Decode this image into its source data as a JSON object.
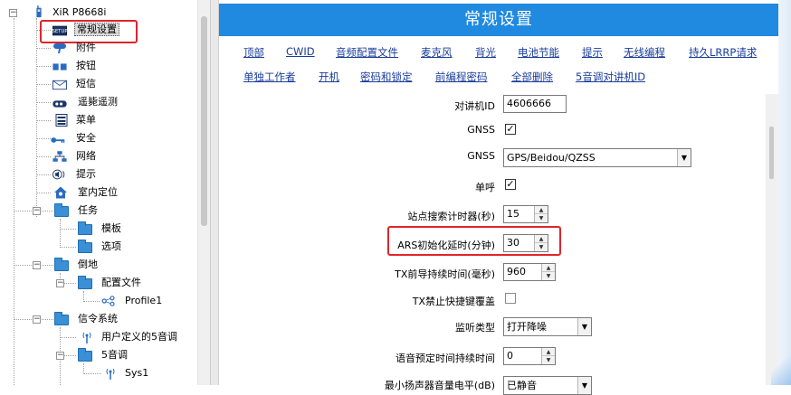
{
  "tree": {
    "root": "XiR P8668i",
    "items": [
      {
        "label": "常规设置",
        "icon": "setting-badge-icon"
      },
      {
        "label": "附件",
        "icon": "accessory-icon"
      },
      {
        "label": "按钮",
        "icon": "button-icon"
      },
      {
        "label": "短信",
        "icon": "envelope-icon"
      },
      {
        "label": "遥毙遥测",
        "icon": "remote-icon"
      },
      {
        "label": "菜单",
        "icon": "menu-icon"
      },
      {
        "label": "安全",
        "icon": "key-icon"
      },
      {
        "label": "网络",
        "icon": "network-icon"
      },
      {
        "label": "提示",
        "icon": "speaker-icon"
      },
      {
        "label": "室内定位",
        "icon": "home-location-icon"
      },
      {
        "label": "任务",
        "icon": "folder-icon"
      },
      {
        "label": "模板",
        "icon": "folder-icon"
      },
      {
        "label": "选项",
        "icon": "folder-icon"
      },
      {
        "label": "倒地",
        "icon": "folder-icon"
      },
      {
        "label": "配置文件",
        "icon": "folder-icon"
      },
      {
        "label": "Profile1",
        "icon": "profile-icon"
      },
      {
        "label": "信令系统",
        "icon": "folder-icon"
      },
      {
        "label": "用户定义的5音调",
        "icon": "antenna-icon"
      },
      {
        "label": "5音调",
        "icon": "folder-icon"
      },
      {
        "label": "Sys1",
        "icon": "antenna-icon"
      }
    ]
  },
  "panel": {
    "title": "常规设置",
    "links_row1": [
      "顶部",
      "CWID",
      "音频配置文件",
      "麦克风",
      "背光",
      "电池节能",
      "提示",
      "无线编程",
      "持久LRRP请求"
    ],
    "links_row2": [
      "单独工作者",
      "开机",
      "密码和锁定",
      "前编程密码",
      "全部删除",
      "5音调对讲机ID"
    ]
  },
  "fields": {
    "radio_id": {
      "label": "对讲机ID",
      "value": "4606666"
    },
    "gnss": {
      "label": "GNSS",
      "checked": true,
      "mark": "✓"
    },
    "gnss_mode": {
      "label": "GNSS",
      "value": "GPS/Beidou/QZSS"
    },
    "single_call": {
      "label": "单呼",
      "checked": true,
      "mark": "✓"
    },
    "site_search_timer": {
      "label": "站点搜索计时器(秒)",
      "value": "15"
    },
    "ars_init_delay": {
      "label": "ARS初始化延时(分钟)",
      "value": "30"
    },
    "tx_preamble": {
      "label": "TX前导持续时间(毫秒)",
      "value": "960"
    },
    "tx_inhibit": {
      "label": "TX禁止快捷键覆盖",
      "checked": false
    },
    "monitor_type": {
      "label": "监听类型",
      "value": "打开降噪"
    },
    "voice_announce": {
      "label": "语音预定时间持续时间",
      "value": "0"
    },
    "min_volume": {
      "label": "最小扬声器音量电平(dB)",
      "value": "已静音"
    }
  },
  "colors": {
    "title_bg": "#1f8ae0",
    "link": "#1a3d99",
    "highlight": "#e0252a"
  }
}
